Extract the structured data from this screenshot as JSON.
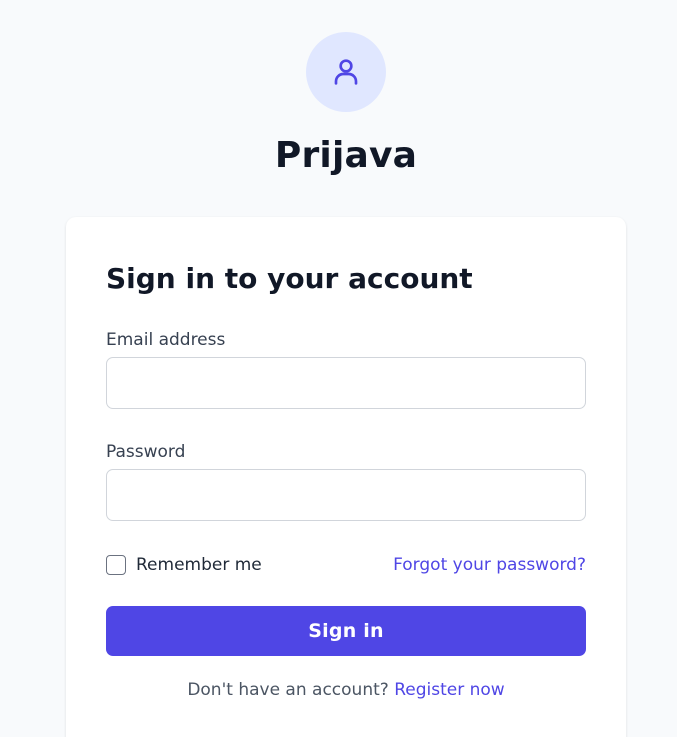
{
  "header": {
    "icon": "user-icon",
    "title": "Prijava"
  },
  "form": {
    "heading": "Sign in to your account",
    "email": {
      "label": "Email address",
      "value": ""
    },
    "password": {
      "label": "Password",
      "value": ""
    },
    "remember": {
      "label": "Remember me",
      "checked": false
    },
    "forgot_link": "Forgot your password?",
    "submit_label": "Sign in",
    "register_prompt": "Don't have an account?",
    "register_link": "Register now"
  },
  "colors": {
    "accent": "#4f46e5",
    "avatar_bg": "#e0e7ff",
    "page_bg": "#f8fafc"
  }
}
